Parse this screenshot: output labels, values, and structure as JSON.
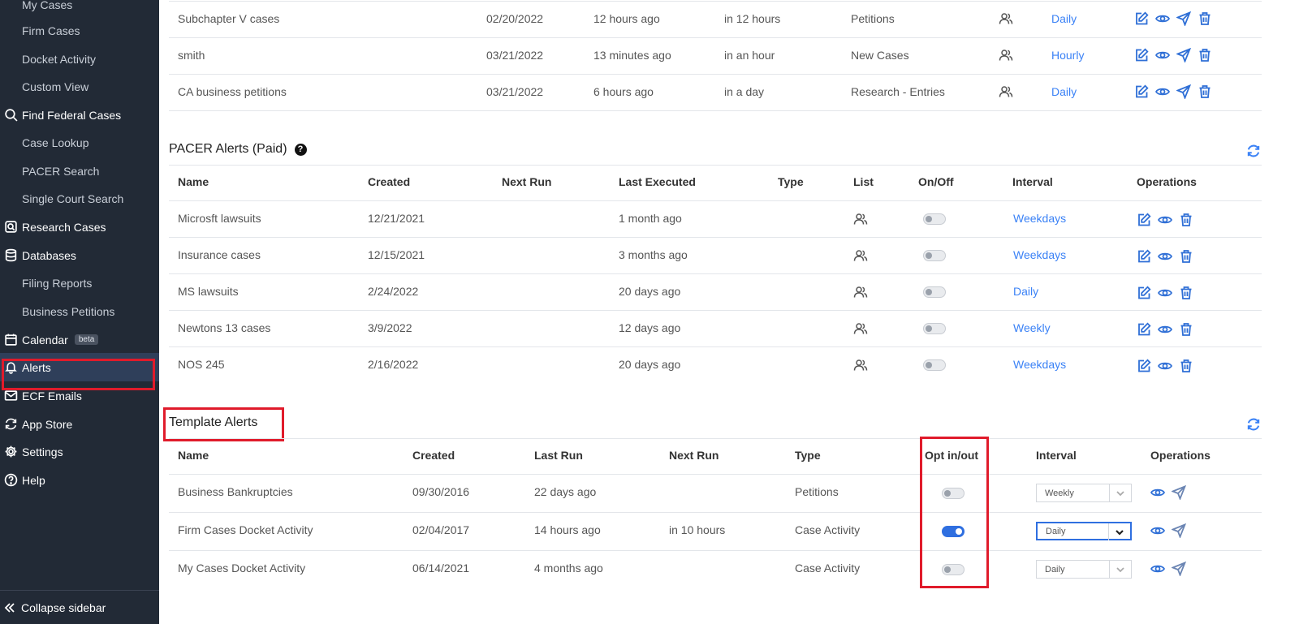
{
  "sidebar": {
    "items": [
      {
        "label": "My Cases",
        "type": "sub"
      },
      {
        "label": "Firm Cases",
        "type": "sub"
      },
      {
        "label": "Docket Activity",
        "type": "sub"
      },
      {
        "label": "Custom View",
        "type": "sub"
      },
      {
        "label": "Find Federal Cases",
        "type": "top",
        "icon": "search-icon"
      },
      {
        "label": "Case Lookup",
        "type": "sub"
      },
      {
        "label": "PACER Search",
        "type": "sub"
      },
      {
        "label": "Single Court Search",
        "type": "sub"
      },
      {
        "label": "Research Cases",
        "type": "top",
        "icon": "research-icon"
      },
      {
        "label": "Databases",
        "type": "top",
        "icon": "database-icon"
      },
      {
        "label": "Filing Reports",
        "type": "sub"
      },
      {
        "label": "Business Petitions",
        "type": "sub"
      },
      {
        "label": "Calendar",
        "type": "top",
        "icon": "calendar-icon",
        "badge": "beta"
      },
      {
        "label": "Alerts",
        "type": "top",
        "icon": "bell-icon",
        "active": true
      },
      {
        "label": "ECF Emails",
        "type": "top",
        "icon": "mail-icon"
      },
      {
        "label": "App Store",
        "type": "top",
        "icon": "refresh-icon"
      },
      {
        "label": "Settings",
        "type": "top",
        "icon": "gear-icon"
      },
      {
        "label": "Help",
        "type": "top",
        "icon": "help-icon"
      }
    ],
    "collapse_label": "Collapse sidebar"
  },
  "top_table": {
    "rows": [
      {
        "name": "Subchapter V cases",
        "created": "02/20/2022",
        "last_run": "12 hours ago",
        "next_run": "in 12 hours",
        "type": "Petitions",
        "interval": "Daily"
      },
      {
        "name": "smith",
        "created": "03/21/2022",
        "last_run": "13 minutes ago",
        "next_run": "in an hour",
        "type": "New Cases",
        "interval": "Hourly"
      },
      {
        "name": "CA business petitions",
        "created": "03/21/2022",
        "last_run": "6 hours ago",
        "next_run": "in a day",
        "type": "Research - Entries",
        "interval": "Daily"
      }
    ]
  },
  "pacer": {
    "title": "PACER Alerts (Paid)",
    "help": "?",
    "headers": [
      "Name",
      "Created",
      "Next Run",
      "Last Executed",
      "Type",
      "List",
      "On/Off",
      "Interval",
      "Operations"
    ],
    "rows": [
      {
        "name": "Microsft lawsuits",
        "created": "12/21/2021",
        "next_run": "",
        "last_executed": "1 month ago",
        "type": "",
        "on": false,
        "interval": "Weekdays"
      },
      {
        "name": "Insurance cases",
        "created": "12/15/2021",
        "next_run": "",
        "last_executed": "3 months ago",
        "type": "",
        "on": false,
        "interval": "Weekdays"
      },
      {
        "name": "MS lawsuits",
        "created": "2/24/2022",
        "next_run": "",
        "last_executed": "20 days ago",
        "type": "",
        "on": false,
        "interval": "Daily"
      },
      {
        "name": "Newtons 13 cases",
        "created": "3/9/2022",
        "next_run": "",
        "last_executed": "12 days ago",
        "type": "",
        "on": false,
        "interval": "Weekly"
      },
      {
        "name": "NOS 245",
        "created": "2/16/2022",
        "next_run": "",
        "last_executed": "20 days ago",
        "type": "",
        "on": false,
        "interval": "Weekdays"
      }
    ]
  },
  "template": {
    "title": "Template Alerts",
    "headers": [
      "Name",
      "Created",
      "Last Run",
      "Next Run",
      "Type",
      "Opt in/out",
      "Interval",
      "Operations"
    ],
    "rows": [
      {
        "name": "Business Bankruptcies",
        "created": "09/30/2016",
        "last_run": "22 days ago",
        "next_run": "",
        "type": "Petitions",
        "opt_in": false,
        "interval": "Weekly"
      },
      {
        "name": "Firm Cases Docket Activity",
        "created": "02/04/2017",
        "last_run": "14 hours ago",
        "next_run": "in 10 hours",
        "type": "Case Activity",
        "opt_in": true,
        "interval": "Daily"
      },
      {
        "name": "My Cases Docket Activity",
        "created": "06/14/2021",
        "last_run": "4 months ago",
        "next_run": "",
        "type": "Case Activity",
        "opt_in": false,
        "interval": "Daily"
      }
    ]
  },
  "colors": {
    "sidebar_bg": "#222a36",
    "accent": "#3b82f6",
    "highlight": "#e01b2b"
  }
}
